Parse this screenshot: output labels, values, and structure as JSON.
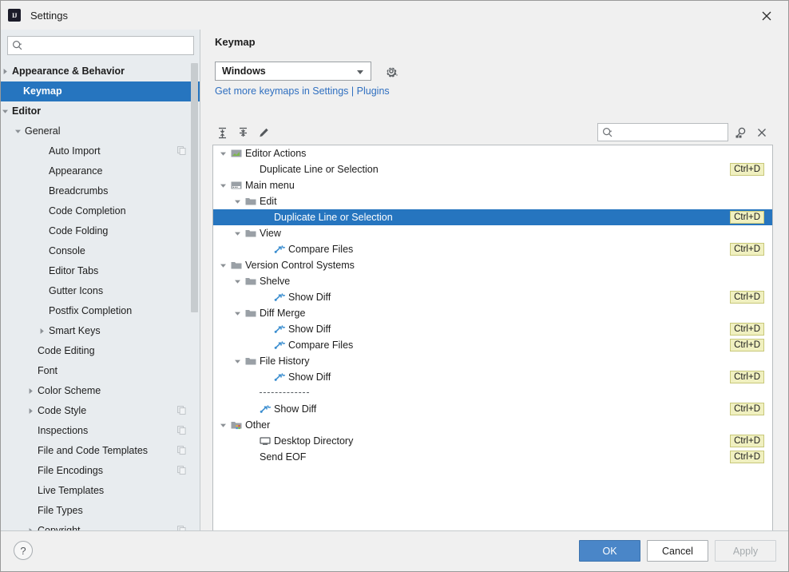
{
  "window": {
    "title": "Settings",
    "app_icon": "IJ",
    "close_icon": "close-icon"
  },
  "sidebar": {
    "search": {
      "placeholder": "",
      "value": "",
      "icon": "search-icon"
    },
    "items": [
      {
        "label": "Appearance & Behavior",
        "indent": 14,
        "arrow": "collapsed",
        "bold": true,
        "selected": false,
        "copy": false
      },
      {
        "label": "Keymap",
        "indent": 28,
        "arrow": "none",
        "bold": true,
        "selected": true,
        "copy": false
      },
      {
        "label": "Editor",
        "indent": 14,
        "arrow": "expanded",
        "bold": true,
        "selected": false,
        "copy": false
      },
      {
        "label": "General",
        "indent": 30,
        "arrow": "expanded",
        "bold": false,
        "selected": false,
        "copy": false
      },
      {
        "label": "Auto Import",
        "indent": 60,
        "arrow": "none",
        "bold": false,
        "selected": false,
        "copy": true
      },
      {
        "label": "Appearance",
        "indent": 60,
        "arrow": "none",
        "bold": false,
        "selected": false,
        "copy": false
      },
      {
        "label": "Breadcrumbs",
        "indent": 60,
        "arrow": "none",
        "bold": false,
        "selected": false,
        "copy": false
      },
      {
        "label": "Code Completion",
        "indent": 60,
        "arrow": "none",
        "bold": false,
        "selected": false,
        "copy": false
      },
      {
        "label": "Code Folding",
        "indent": 60,
        "arrow": "none",
        "bold": false,
        "selected": false,
        "copy": false
      },
      {
        "label": "Console",
        "indent": 60,
        "arrow": "none",
        "bold": false,
        "selected": false,
        "copy": false
      },
      {
        "label": "Editor Tabs",
        "indent": 60,
        "arrow": "none",
        "bold": false,
        "selected": false,
        "copy": false
      },
      {
        "label": "Gutter Icons",
        "indent": 60,
        "arrow": "none",
        "bold": false,
        "selected": false,
        "copy": false
      },
      {
        "label": "Postfix Completion",
        "indent": 60,
        "arrow": "none",
        "bold": false,
        "selected": false,
        "copy": false
      },
      {
        "label": "Smart Keys",
        "indent": 60,
        "arrow": "collapsed",
        "bold": false,
        "selected": false,
        "copy": false
      },
      {
        "label": "Code Editing",
        "indent": 46,
        "arrow": "none",
        "bold": false,
        "selected": false,
        "copy": false
      },
      {
        "label": "Font",
        "indent": 46,
        "arrow": "none",
        "bold": false,
        "selected": false,
        "copy": false
      },
      {
        "label": "Color Scheme",
        "indent": 46,
        "arrow": "collapsed",
        "bold": false,
        "selected": false,
        "copy": false
      },
      {
        "label": "Code Style",
        "indent": 46,
        "arrow": "collapsed",
        "bold": false,
        "selected": false,
        "copy": true
      },
      {
        "label": "Inspections",
        "indent": 46,
        "arrow": "none",
        "bold": false,
        "selected": false,
        "copy": true
      },
      {
        "label": "File and Code Templates",
        "indent": 46,
        "arrow": "none",
        "bold": false,
        "selected": false,
        "copy": true
      },
      {
        "label": "File Encodings",
        "indent": 46,
        "arrow": "none",
        "bold": false,
        "selected": false,
        "copy": true
      },
      {
        "label": "Live Templates",
        "indent": 46,
        "arrow": "none",
        "bold": false,
        "selected": false,
        "copy": false
      },
      {
        "label": "File Types",
        "indent": 46,
        "arrow": "none",
        "bold": false,
        "selected": false,
        "copy": false
      },
      {
        "label": "Copyright",
        "indent": 46,
        "arrow": "collapsed",
        "bold": false,
        "selected": false,
        "copy": true
      }
    ]
  },
  "keymap_panel": {
    "title": "Keymap",
    "selected_keymap": "Windows",
    "gear_icon": "gear-icon",
    "link_text": "Get more keymaps in Settings",
    "link_separator": "|",
    "link_text2": "Plugins",
    "toolbar": {
      "expand_all_icon": "expand-all-icon",
      "collapse_all_icon": "collapse-all-icon",
      "edit_icon": "pencil-edit-icon",
      "search_placeholder": "",
      "search_value": "",
      "search_icon": "search-icon",
      "find_shortcut_icon": "find-by-shortcut-icon",
      "clear_icon": "close-icon"
    },
    "rows": [
      {
        "label": "Editor Actions",
        "indent": 22,
        "arrow": "expanded",
        "icon": "editor-actions-icon",
        "shortcut": "",
        "selected": false
      },
      {
        "label": "Duplicate Line or Selection",
        "indent": 58,
        "arrow": "none",
        "icon": "none",
        "shortcut": "Ctrl+D",
        "selected": false
      },
      {
        "label": "Main menu",
        "indent": 22,
        "arrow": "expanded",
        "icon": "main-menu-icon",
        "shortcut": "",
        "selected": false
      },
      {
        "label": "Edit",
        "indent": 40,
        "arrow": "expanded",
        "icon": "folder-icon",
        "shortcut": "",
        "selected": false
      },
      {
        "label": "Duplicate Line or Selection",
        "indent": 76,
        "arrow": "none",
        "icon": "none",
        "shortcut": "Ctrl+D",
        "selected": true
      },
      {
        "label": "View",
        "indent": 40,
        "arrow": "expanded",
        "icon": "folder-icon",
        "shortcut": "",
        "selected": false
      },
      {
        "label": "Compare Files",
        "indent": 76,
        "arrow": "none",
        "icon": "diff-action-icon",
        "shortcut": "Ctrl+D",
        "selected": false
      },
      {
        "label": "Version Control Systems",
        "indent": 22,
        "arrow": "expanded",
        "icon": "folder-icon",
        "shortcut": "",
        "selected": false
      },
      {
        "label": "Shelve",
        "indent": 40,
        "arrow": "expanded",
        "icon": "folder-icon",
        "shortcut": "",
        "selected": false
      },
      {
        "label": "Show Diff",
        "indent": 76,
        "arrow": "none",
        "icon": "diff-action-icon",
        "shortcut": "Ctrl+D",
        "selected": false
      },
      {
        "label": "Diff  Merge",
        "indent": 40,
        "arrow": "expanded",
        "icon": "folder-icon",
        "shortcut": "",
        "selected": false
      },
      {
        "label": "Show Diff",
        "indent": 76,
        "arrow": "none",
        "icon": "diff-action-icon",
        "shortcut": "Ctrl+D",
        "selected": false
      },
      {
        "label": "Compare Files",
        "indent": 76,
        "arrow": "none",
        "icon": "diff-action-icon",
        "shortcut": "Ctrl+D",
        "selected": false
      },
      {
        "label": "File History",
        "indent": 40,
        "arrow": "expanded",
        "icon": "folder-icon",
        "shortcut": "",
        "selected": false
      },
      {
        "label": "Show Diff",
        "indent": 76,
        "arrow": "none",
        "icon": "diff-action-icon",
        "shortcut": "Ctrl+D",
        "selected": false
      },
      {
        "label": "",
        "indent": 58,
        "arrow": "none",
        "icon": "separator-dashes",
        "shortcut": "",
        "selected": false
      },
      {
        "label": "Show Diff",
        "indent": 58,
        "arrow": "none",
        "icon": "diff-action-icon",
        "shortcut": "Ctrl+D",
        "selected": false
      },
      {
        "label": "Other",
        "indent": 22,
        "arrow": "expanded",
        "icon": "other-icon",
        "shortcut": "",
        "selected": false
      },
      {
        "label": "Desktop Directory",
        "indent": 58,
        "arrow": "none",
        "icon": "desktop-icon",
        "shortcut": "Ctrl+D",
        "selected": false
      },
      {
        "label": "Send EOF",
        "indent": 58,
        "arrow": "none",
        "icon": "none",
        "shortcut": "Ctrl+D",
        "selected": false
      }
    ]
  },
  "footer": {
    "help_label": "?",
    "ok_label": "OK",
    "cancel_label": "Cancel",
    "apply_label": "Apply"
  },
  "colors": {
    "selection_blue": "#2675bf",
    "link_blue": "#2f6fc0",
    "badge_bg": "#f0f0c0",
    "badge_border": "#c8c87a",
    "sidebar_bg": "#e8ecef",
    "dialog_bg": "#f0f0f0",
    "ok_button": "#4a86c8"
  }
}
